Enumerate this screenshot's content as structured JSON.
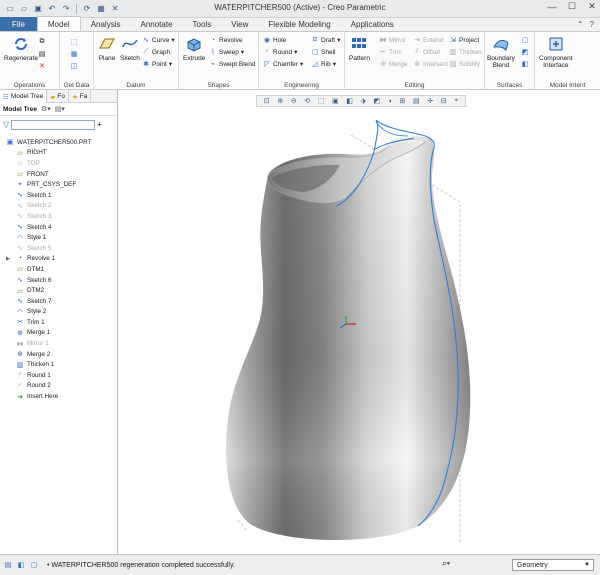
{
  "window": {
    "title": "WATERPITCHER500 (Active) - Creo Parametric"
  },
  "quick_access": [
    "new-icon",
    "open-icon",
    "save-icon",
    "undo-icon",
    "redo-icon",
    "regenerate-icon",
    "windows-icon",
    "close-icon"
  ],
  "tabs": [
    "File",
    "Model",
    "Analysis",
    "Annotate",
    "Tools",
    "View",
    "Flexible Modeling",
    "Applications"
  ],
  "active_tab": "Model",
  "ribbon": {
    "operations": {
      "label": "Operations",
      "regenerate": "Regenerate"
    },
    "get_data": {
      "label": "Get Data"
    },
    "datum": {
      "label": "Datum",
      "plane": "Plane",
      "sketch": "Sketch",
      "curve": "Curve",
      "graph": "Graph",
      "point": "Point"
    },
    "shapes": {
      "label": "Shapes",
      "extrude": "Extrude",
      "revolve": "Revolve",
      "sweep": "Sweep",
      "swept_blend": "Swept Blend"
    },
    "engineering": {
      "label": "Engineering",
      "hole": "Hole",
      "round": "Round",
      "chamfer": "Chamfer",
      "draft": "Draft",
      "shell": "Shell",
      "rib": "Rib"
    },
    "editing": {
      "label": "Editing",
      "pattern": "Pattern",
      "mirror": "Mirror",
      "trim": "Trim",
      "merge": "Merge",
      "extend": "Extend",
      "offset": "Offset",
      "intersect": "Intersect",
      "project": "Project",
      "thicken": "Thicken",
      "solidify": "Solidify"
    },
    "surfaces": {
      "label": "Surfaces",
      "boundary_blend": "Boundary\nBlend"
    },
    "model_intent": {
      "label": "Model Intent",
      "component_interface": "Component\nInterface"
    }
  },
  "panel": {
    "tabs": [
      "Model Tree",
      "Fo",
      "Fa"
    ],
    "toolbar_label": "Model Tree"
  },
  "tree": [
    {
      "label": "WATERPITCHER500.PRT",
      "icon": "part-icon",
      "state": "normal"
    },
    {
      "label": "RIGHT",
      "icon": "datum-plane-icon",
      "state": "normal"
    },
    {
      "label": "TOP",
      "icon": "datum-plane-icon",
      "state": "suppressed"
    },
    {
      "label": "FRONT",
      "icon": "datum-plane-icon",
      "state": "normal"
    },
    {
      "label": "PRT_CSYS_DEF",
      "icon": "csys-icon",
      "state": "normal"
    },
    {
      "label": "Sketch 1",
      "icon": "sketch-icon",
      "state": "normal"
    },
    {
      "label": "Sketch 2",
      "icon": "sketch-icon",
      "state": "suppressed"
    },
    {
      "label": "Sketch 3",
      "icon": "sketch-icon",
      "state": "suppressed"
    },
    {
      "label": "Sketch 4",
      "icon": "sketch-icon",
      "state": "normal"
    },
    {
      "label": "Style 1",
      "icon": "style-icon",
      "state": "normal"
    },
    {
      "label": "Sketch 5",
      "icon": "sketch-icon",
      "state": "suppressed"
    },
    {
      "label": "Revolve 1",
      "icon": "revolve-icon",
      "state": "normal",
      "expandable": true
    },
    {
      "label": "DTM1",
      "icon": "datum-plane-icon",
      "state": "normal"
    },
    {
      "label": "Sketch 6",
      "icon": "sketch-icon",
      "state": "normal"
    },
    {
      "label": "DTM2",
      "icon": "datum-plane-icon",
      "state": "normal"
    },
    {
      "label": "Sketch 7",
      "icon": "sketch-icon",
      "state": "normal"
    },
    {
      "label": "Style 2",
      "icon": "style-icon",
      "state": "normal"
    },
    {
      "label": "Trim 1",
      "icon": "trim-icon",
      "state": "normal"
    },
    {
      "label": "Merge 1",
      "icon": "merge-icon",
      "state": "normal"
    },
    {
      "label": "Mirror 1",
      "icon": "mirror-icon",
      "state": "suppressed"
    },
    {
      "label": "Merge 2",
      "icon": "merge-icon",
      "state": "normal"
    },
    {
      "label": "Thicken 1",
      "icon": "thicken-icon",
      "state": "normal"
    },
    {
      "label": "Round 1",
      "icon": "round-icon",
      "state": "normal"
    },
    {
      "label": "Round 2",
      "icon": "round-icon",
      "state": "normal"
    },
    {
      "label": "Insert Here",
      "icon": "insert-here-icon",
      "state": "normal"
    }
  ],
  "status": {
    "message": "• WATERPITCHER500 regeneration completed successfully.",
    "filter_value": "Geometry"
  },
  "colors": {
    "accent": "#3b6faa",
    "sketch_curve": "#2f7fd6",
    "csys_red": "#d0202a",
    "csys_green": "#1aa83a",
    "csys_blue": "#2a62d8"
  }
}
